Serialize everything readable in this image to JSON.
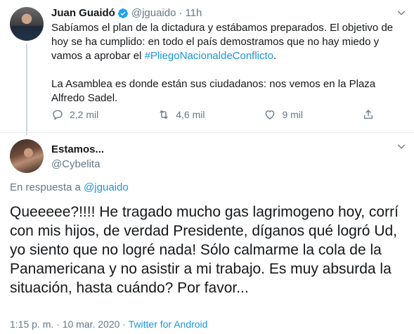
{
  "parent_tweet": {
    "author_name": "Juan Guaidó",
    "handle": "@jguaido",
    "separator": "·",
    "age": "11h",
    "text_line1_before": "Sabíamos el plan de la dictadura y estábamos preparados. El objetivo de hoy se ha cumplido: en todo el país demostramos que no hay miedo y vamos a aprobar el ",
    "hashtag": "#PliegoNacionaldeConflicto",
    "text_line1_after": ".",
    "text_line2": "La Asamblea es donde están sus ciudadanos: nos vemos en la Plaza Alfredo Sadel.",
    "replies": "2,2 mil",
    "retweets": "4,6 mil",
    "likes": "9 mil",
    "verified_icon": "verified-badge-icon",
    "colors": {
      "verified": "#1da1f2",
      "link": "#1b95e0",
      "muted": "#657786"
    }
  },
  "reply_tweet": {
    "author_name": "Estamos...",
    "handle": "@Cybelita",
    "in_reply_prefix": "En respuesta a ",
    "in_reply_handle": "@jguaido",
    "text": "Queeeee?!!!! He tragado mucho gas lagrimogeno hoy, corrí con mis hijos, de verdad Presidente, díganos qué logró Ud, yo siento que no logré nada! Sólo calmarme la cola de la Panamericana y no asistir a mi trabajo. Es muy absurda la situación, hasta cuándo? Por favor...",
    "timestamp": "1:15 p. m. · 10 mar. 2020",
    "meta_separator": " · ",
    "source": "Twitter for Android"
  }
}
